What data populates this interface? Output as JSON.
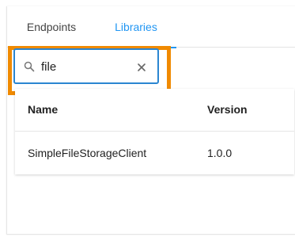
{
  "tabs": [
    {
      "label": "Endpoints",
      "active": false
    },
    {
      "label": "Libraries",
      "active": true
    }
  ],
  "search": {
    "value": "file",
    "icon": "search-icon",
    "clear_icon": "close-icon"
  },
  "table": {
    "columns": [
      "Name",
      "Version"
    ],
    "rows": [
      {
        "name": "SimpleFileStorageClient",
        "version": "1.0.0"
      }
    ]
  },
  "colors": {
    "accent": "#2196f3",
    "highlight": "#f08a00",
    "input_border": "#2b86d1"
  }
}
